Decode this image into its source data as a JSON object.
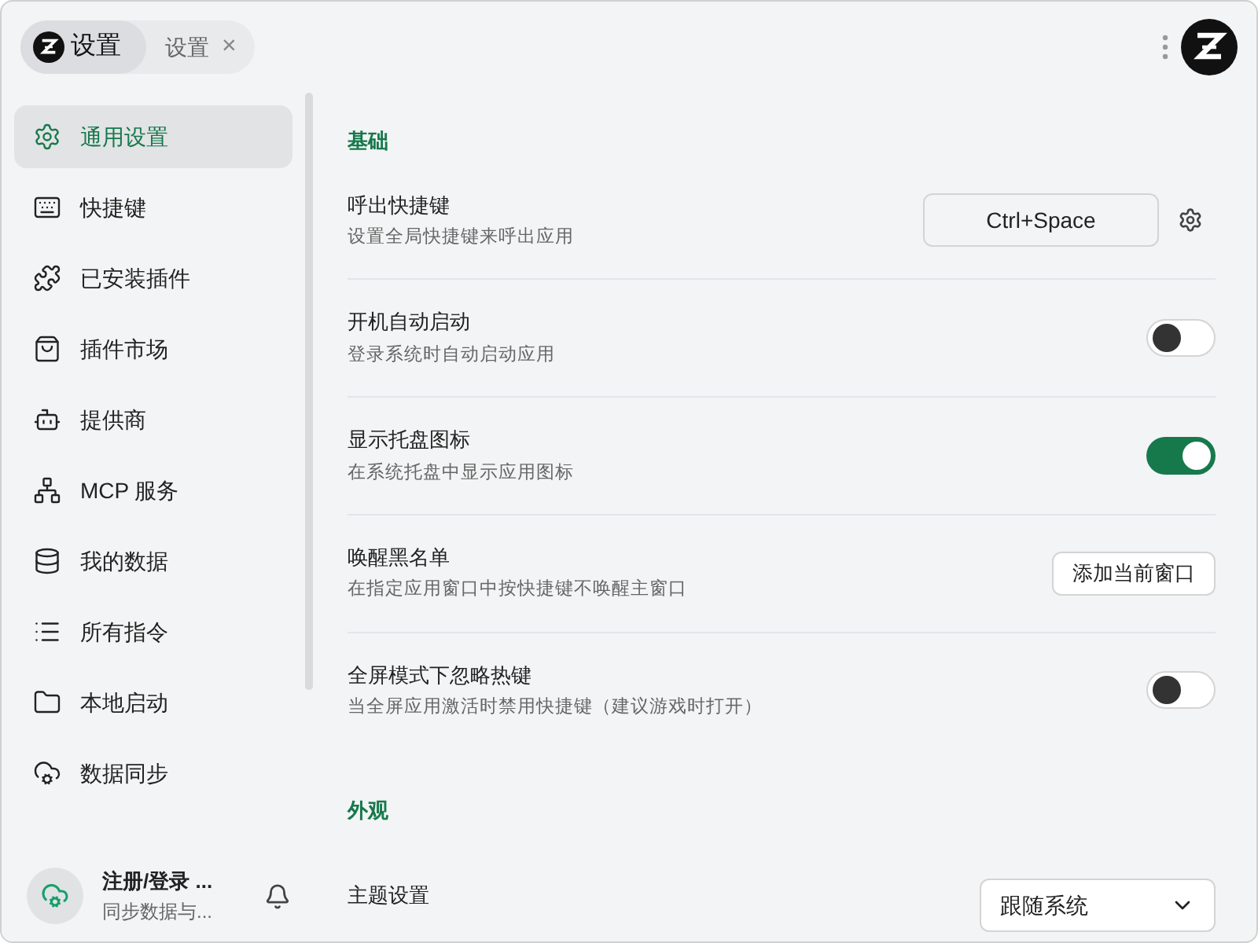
{
  "tab_bar": {
    "app_tab": {
      "label": "设置"
    },
    "page_tab": {
      "label": "设置",
      "close": "×"
    }
  },
  "sidebar": {
    "items": [
      {
        "label": "通用设置",
        "selected": true
      },
      {
        "label": "快捷键",
        "selected": false
      },
      {
        "label": "已安装插件",
        "selected": false
      },
      {
        "label": "插件市场",
        "selected": false
      },
      {
        "label": "提供商",
        "selected": false
      },
      {
        "label": "MCP 服务",
        "selected": false
      },
      {
        "label": "我的数据",
        "selected": false
      },
      {
        "label": "所有指令",
        "selected": false
      },
      {
        "label": "本地启动",
        "selected": false
      },
      {
        "label": "数据同步",
        "selected": false
      }
    ],
    "account": {
      "title": "注册/登录 ...",
      "subtitle": "同步数据与..."
    }
  },
  "sections": [
    {
      "title": "基础",
      "rows": [
        {
          "kind": "shortcut",
          "title": "呼出快捷键",
          "description": "设置全局快捷键来呼出应用",
          "value": "Ctrl+Space"
        },
        {
          "kind": "toggle",
          "title": "开机自动启动",
          "description": "登录系统时自动启动应用",
          "on": false
        },
        {
          "kind": "toggle",
          "title": "显示托盘图标",
          "description": "在系统托盘中显示应用图标",
          "on": true
        },
        {
          "kind": "button",
          "title": "唤醒黑名单",
          "description": "在指定应用窗口中按快捷键不唤醒主窗口",
          "button": "添加当前窗口"
        },
        {
          "kind": "toggle",
          "title": "全屏模式下忽略热键",
          "description": "当全屏应用激活时禁用快捷键（建议游戏时打开）",
          "on": false
        }
      ]
    },
    {
      "title": "外观",
      "rows": [
        {
          "kind": "select",
          "title": "主题设置",
          "value": "跟随系统"
        }
      ]
    }
  ]
}
